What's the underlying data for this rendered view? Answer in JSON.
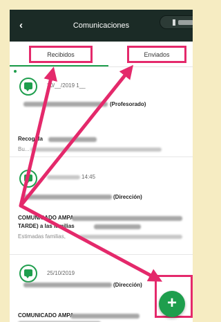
{
  "appbar": {
    "title": "Comunicaciones",
    "back_glyph": "‹"
  },
  "tabs": {
    "received": "Recibidos",
    "sent": "Enviados",
    "active": "received"
  },
  "messages": [
    {
      "date": "30/__/2019 1__",
      "sender_suffix": "(Profesorado)",
      "subject": "Recogida",
      "preview": "Bu..."
    },
    {
      "date": "14:45",
      "sender_suffix": "(Dirección)",
      "subject": "COMUNICADO AMPA",
      "subject_line2": "TARDE) a las familias",
      "preview": "Estimadas familias,"
    },
    {
      "date": "25/10/2019",
      "sender_suffix": "(Dirección)",
      "subject": "COMUNICADO AMPA"
    }
  ],
  "fab": {
    "icon": "plus-icon",
    "glyph": "+"
  },
  "colors": {
    "appbar": "#1b2b26",
    "accent_green": "#1e9e4d",
    "highlight_pink": "#e4296b",
    "background": "#f6ecc2"
  }
}
